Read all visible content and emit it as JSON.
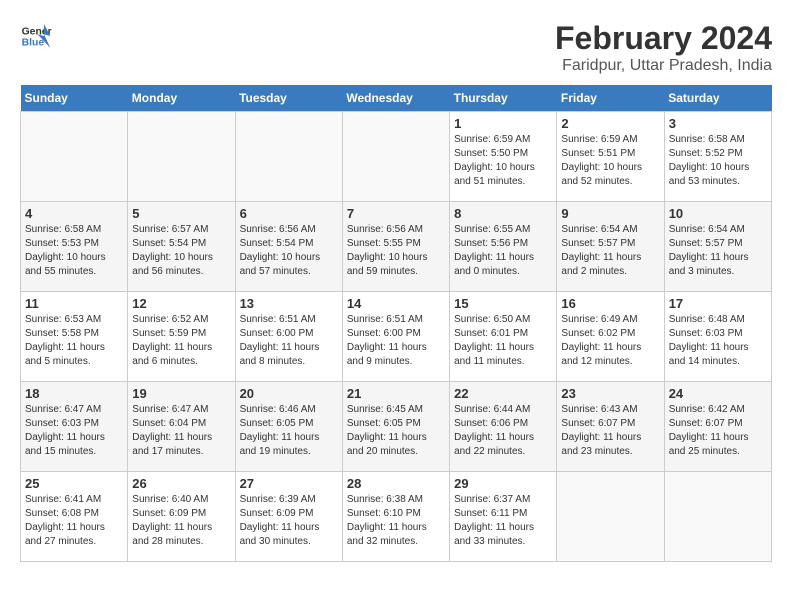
{
  "logo": {
    "line1": "General",
    "line2": "Blue"
  },
  "title": "February 2024",
  "subtitle": "Faridpur, Uttar Pradesh, India",
  "days_of_week": [
    "Sunday",
    "Monday",
    "Tuesday",
    "Wednesday",
    "Thursday",
    "Friday",
    "Saturday"
  ],
  "weeks": [
    [
      {
        "day": "",
        "info": ""
      },
      {
        "day": "",
        "info": ""
      },
      {
        "day": "",
        "info": ""
      },
      {
        "day": "",
        "info": ""
      },
      {
        "day": "1",
        "info": "Sunrise: 6:59 AM\nSunset: 5:50 PM\nDaylight: 10 hours\nand 51 minutes."
      },
      {
        "day": "2",
        "info": "Sunrise: 6:59 AM\nSunset: 5:51 PM\nDaylight: 10 hours\nand 52 minutes."
      },
      {
        "day": "3",
        "info": "Sunrise: 6:58 AM\nSunset: 5:52 PM\nDaylight: 10 hours\nand 53 minutes."
      }
    ],
    [
      {
        "day": "4",
        "info": "Sunrise: 6:58 AM\nSunset: 5:53 PM\nDaylight: 10 hours\nand 55 minutes."
      },
      {
        "day": "5",
        "info": "Sunrise: 6:57 AM\nSunset: 5:54 PM\nDaylight: 10 hours\nand 56 minutes."
      },
      {
        "day": "6",
        "info": "Sunrise: 6:56 AM\nSunset: 5:54 PM\nDaylight: 10 hours\nand 57 minutes."
      },
      {
        "day": "7",
        "info": "Sunrise: 6:56 AM\nSunset: 5:55 PM\nDaylight: 10 hours\nand 59 minutes."
      },
      {
        "day": "8",
        "info": "Sunrise: 6:55 AM\nSunset: 5:56 PM\nDaylight: 11 hours\nand 0 minutes."
      },
      {
        "day": "9",
        "info": "Sunrise: 6:54 AM\nSunset: 5:57 PM\nDaylight: 11 hours\nand 2 minutes."
      },
      {
        "day": "10",
        "info": "Sunrise: 6:54 AM\nSunset: 5:57 PM\nDaylight: 11 hours\nand 3 minutes."
      }
    ],
    [
      {
        "day": "11",
        "info": "Sunrise: 6:53 AM\nSunset: 5:58 PM\nDaylight: 11 hours\nand 5 minutes."
      },
      {
        "day": "12",
        "info": "Sunrise: 6:52 AM\nSunset: 5:59 PM\nDaylight: 11 hours\nand 6 minutes."
      },
      {
        "day": "13",
        "info": "Sunrise: 6:51 AM\nSunset: 6:00 PM\nDaylight: 11 hours\nand 8 minutes."
      },
      {
        "day": "14",
        "info": "Sunrise: 6:51 AM\nSunset: 6:00 PM\nDaylight: 11 hours\nand 9 minutes."
      },
      {
        "day": "15",
        "info": "Sunrise: 6:50 AM\nSunset: 6:01 PM\nDaylight: 11 hours\nand 11 minutes."
      },
      {
        "day": "16",
        "info": "Sunrise: 6:49 AM\nSunset: 6:02 PM\nDaylight: 11 hours\nand 12 minutes."
      },
      {
        "day": "17",
        "info": "Sunrise: 6:48 AM\nSunset: 6:03 PM\nDaylight: 11 hours\nand 14 minutes."
      }
    ],
    [
      {
        "day": "18",
        "info": "Sunrise: 6:47 AM\nSunset: 6:03 PM\nDaylight: 11 hours\nand 15 minutes."
      },
      {
        "day": "19",
        "info": "Sunrise: 6:47 AM\nSunset: 6:04 PM\nDaylight: 11 hours\nand 17 minutes."
      },
      {
        "day": "20",
        "info": "Sunrise: 6:46 AM\nSunset: 6:05 PM\nDaylight: 11 hours\nand 19 minutes."
      },
      {
        "day": "21",
        "info": "Sunrise: 6:45 AM\nSunset: 6:05 PM\nDaylight: 11 hours\nand 20 minutes."
      },
      {
        "day": "22",
        "info": "Sunrise: 6:44 AM\nSunset: 6:06 PM\nDaylight: 11 hours\nand 22 minutes."
      },
      {
        "day": "23",
        "info": "Sunrise: 6:43 AM\nSunset: 6:07 PM\nDaylight: 11 hours\nand 23 minutes."
      },
      {
        "day": "24",
        "info": "Sunrise: 6:42 AM\nSunset: 6:07 PM\nDaylight: 11 hours\nand 25 minutes."
      }
    ],
    [
      {
        "day": "25",
        "info": "Sunrise: 6:41 AM\nSunset: 6:08 PM\nDaylight: 11 hours\nand 27 minutes."
      },
      {
        "day": "26",
        "info": "Sunrise: 6:40 AM\nSunset: 6:09 PM\nDaylight: 11 hours\nand 28 minutes."
      },
      {
        "day": "27",
        "info": "Sunrise: 6:39 AM\nSunset: 6:09 PM\nDaylight: 11 hours\nand 30 minutes."
      },
      {
        "day": "28",
        "info": "Sunrise: 6:38 AM\nSunset: 6:10 PM\nDaylight: 11 hours\nand 32 minutes."
      },
      {
        "day": "29",
        "info": "Sunrise: 6:37 AM\nSunset: 6:11 PM\nDaylight: 11 hours\nand 33 minutes."
      },
      {
        "day": "",
        "info": ""
      },
      {
        "day": "",
        "info": ""
      }
    ]
  ]
}
